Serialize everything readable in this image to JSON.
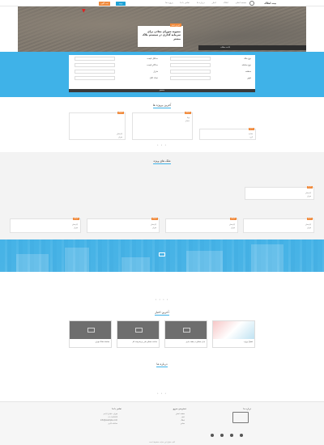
{
  "header": {
    "logo_text": "بیت املاک",
    "nav": [
      "صفحه اصلی",
      "املاک",
      "اخبار",
      "درباره ما",
      "تماس با ما",
      "پروژه ها"
    ],
    "login_label": "ورود",
    "register_label": "ثبت آگهی"
  },
  "hero": {
    "badge": "آخرین اخبار",
    "title": "مصوبه شورای معادن برای سرمایه گذاری در سیستم بلاک بیشتر",
    "strip_text": "ادامه مطلب"
  },
  "search": {
    "rows_right": [
      "نوع ملک",
      "نوع معامله",
      "منطقه",
      "شهر"
    ],
    "rows_mid": [
      "حداقل قیمت",
      "حداکثر قیمت",
      "متراژ",
      "تعداد اتاق"
    ],
    "submit_label": "جستجو"
  },
  "sections": {
    "latest_props": "آخرین پروژه ها",
    "special_props": "ملک های ویژه",
    "latest_news": "آخرین اخبار",
    "about": "درباره ما"
  },
  "cards_row1": [
    {
      "tag": "فروش",
      "lines": [
        "آپارتمان",
        "تهران"
      ]
    },
    {
      "tag": "فروش",
      "lines": [
        "ویلا",
        "شمال"
      ]
    },
    {
      "tag": "اجاره",
      "lines": [
        "مغازه",
        "کرج"
      ]
    }
  ],
  "cards_row2": [
    {
      "tag": "فروش",
      "lines": [
        "آپارتمان",
        "تهران"
      ]
    },
    {
      "tag": "فروش",
      "lines": [
        "آپارتمان",
        "تهران"
      ]
    },
    {
      "tag": "فروش",
      "lines": [
        "آپارتمان",
        "تهران"
      ]
    },
    {
      "tag": "اجاره",
      "lines": [
        "آپارتمان",
        "تهران"
      ]
    }
  ],
  "news": [
    {
      "caption": "افتتاح پروژه"
    },
    {
      "caption": "بازار مسکن در هفته جاری"
    },
    {
      "caption": "ساخت مسکن ملی و پیشرفت کار"
    },
    {
      "caption": "معامله املاک تهران"
    }
  ],
  "footer": {
    "col_about": "درباره ما",
    "col_links": "دسترسی سریع",
    "col_contact": "تماس با ما",
    "links": [
      "صفحه اصلی",
      "اخبار",
      "املاک",
      "تماس"
    ],
    "contact": [
      "تهران، خیابان آزادی",
      "۰۲۱-۱۲۳۴۵۶۷",
      "info@example.com",
      "ساعات کاری"
    ],
    "copyright": "کلیه حقوق این سایت محفوظ است"
  },
  "colors": {
    "accent": "#3fb2e8",
    "orange": "#f08a3c",
    "dark": "#3a3a3a"
  }
}
